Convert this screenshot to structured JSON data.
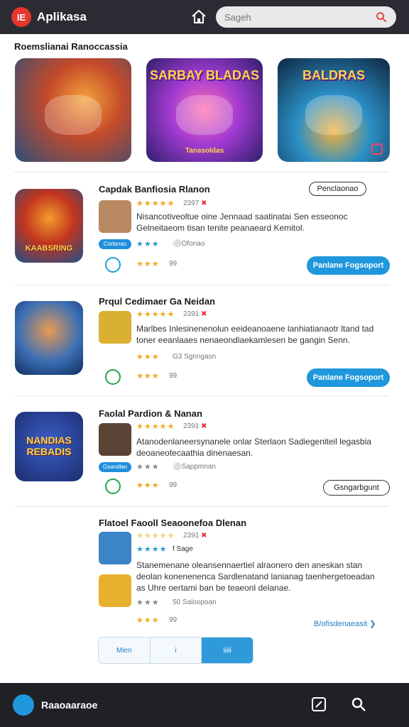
{
  "header": {
    "logo_text": "IE",
    "app_title": "Aplikasa",
    "search_placeholder": "Sageh"
  },
  "section_heading": "Roemslianai Ranoccassia",
  "featured": [
    {
      "title": "",
      "subtitle": ""
    },
    {
      "title": "SARBAY BLADAS",
      "subtitle": "Tanasoldas"
    },
    {
      "title": "BALDRAS",
      "subtitle": ""
    }
  ],
  "rows": [
    {
      "title": "Capdak Banfiosia Rlanon",
      "icon_text": "KAABSRING",
      "tag": "Penclaonao",
      "rating_text": "2397",
      "description": "Nisancotiveoltue oine Jennaad saatinatai Sen esseonoc Gelneitaeom tisan tenite peanaeard Kemitol.",
      "chip": "Corlanao",
      "sub_rating": "Ofonao",
      "small_rating": "99",
      "button": "Panlane Fogsoport"
    },
    {
      "title": "Prqul Cedimaer Ga Neidan",
      "icon_text": "",
      "rating_text": "2391",
      "description": "Marlbes Inlesinenenolun eeideanoaene lanhiatianaotr ltand tad toner eeanlaaes nenaeondlaekamlesen be gangin Senn.",
      "sub_rating": "G3 Sgnngasn",
      "small_rating": "99",
      "button": "Panlane Fogsoport"
    },
    {
      "title": "Faolal Pardion & Nanan",
      "icon_text": "NANDIAS REBADIS",
      "rating_text": "2391",
      "description": "Atanodenlaneersynanele onlar Sterlaon Sadiegeniteil legasbia deoaneotecaathia dinenaesan.",
      "chip": "Gsandlan",
      "sub_rating": "Sappmnan",
      "small_rating": "99",
      "button": "Gsngarbgunt"
    },
    {
      "title": "Flatoel Faooll Seaoonefoa Dlenan",
      "rating_text": "2391",
      "tag_small": "f Sage",
      "description": "Stanemenane oleansennaertiel alraonero den aneskan stan deolan konenenenca Sardlenatand lanianag taenhergetoeadan as Uhre oertami ban be teaeonl delanae.",
      "sub_rating": "50 Saloopoan",
      "small_rating": "99",
      "more_link": "B/ofisdenaeasit"
    }
  ],
  "segmented": [
    "Mien",
    "i",
    "iiiii"
  ],
  "bottom": {
    "title": "Raaoaaraoe"
  }
}
